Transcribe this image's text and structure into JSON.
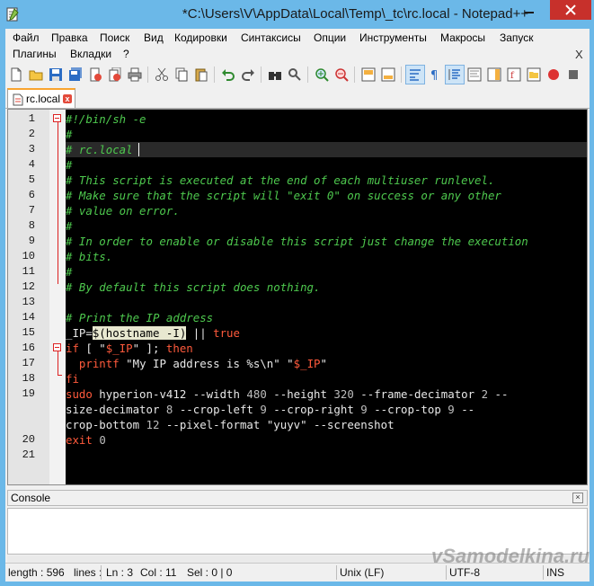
{
  "window": {
    "title": "*C:\\Users\\V\\AppData\\Local\\Temp\\_tc\\rc.local - Notepad++",
    "minimize_label": "minimize",
    "close_label": "close"
  },
  "menu": {
    "items": [
      "Файл",
      "Правка",
      "Поиск",
      "Вид",
      "Кодировки",
      "Синтаксисы",
      "Опции",
      "Инструменты",
      "Макросы",
      "Запуск",
      "Плагины",
      "Вкладки",
      "?"
    ],
    "close_x": "X"
  },
  "tab": {
    "label": "rc.local"
  },
  "editor": {
    "lines": [
      {
        "n": "1",
        "segs": [
          [
            "c-comment",
            "#!/bin/sh -e"
          ]
        ]
      },
      {
        "n": "2",
        "segs": [
          [
            "c-comment",
            "#"
          ]
        ]
      },
      {
        "n": "3",
        "segs": [
          [
            "c-comment",
            "# rc.local"
          ]
        ]
      },
      {
        "n": "4",
        "segs": [
          [
            "c-comment",
            "#"
          ]
        ]
      },
      {
        "n": "5",
        "segs": [
          [
            "c-comment",
            "# This script is executed at the end of each multiuser runlevel."
          ]
        ]
      },
      {
        "n": "6",
        "segs": [
          [
            "c-comment",
            "# Make sure that the script will \"exit 0\" on success or any other"
          ]
        ]
      },
      {
        "n": "7",
        "segs": [
          [
            "c-comment",
            "# value on error."
          ]
        ]
      },
      {
        "n": "8",
        "segs": [
          [
            "c-comment",
            "#"
          ]
        ]
      },
      {
        "n": "9",
        "segs": [
          [
            "c-comment",
            "# In order to enable or disable this script just change the execution"
          ]
        ]
      },
      {
        "n": "10",
        "segs": [
          [
            "c-comment",
            "# bits."
          ]
        ]
      },
      {
        "n": "11",
        "segs": [
          [
            "c-comment",
            "#"
          ]
        ]
      },
      {
        "n": "12",
        "segs": [
          [
            "c-comment",
            "# By default this script does nothing."
          ]
        ]
      },
      {
        "n": "13",
        "segs": []
      },
      {
        "n": "14",
        "segs": [
          [
            "c-comment",
            "# Print the IP address"
          ]
        ]
      },
      {
        "n": "15",
        "segs": [
          [
            "c-plain",
            "_IP="
          ],
          [
            "c-hl",
            "$(hostname -I)"
          ],
          [
            "c-plain",
            " || "
          ],
          [
            "c-kw",
            "true"
          ]
        ]
      },
      {
        "n": "16",
        "segs": [
          [
            "c-kw",
            "if"
          ],
          [
            "c-plain",
            " [ \""
          ],
          [
            "c-kw",
            "$_IP"
          ],
          [
            "c-plain",
            "\" ]; "
          ],
          [
            "c-kw",
            "then"
          ]
        ]
      },
      {
        "n": "17",
        "segs": [
          [
            "c-plain",
            "  "
          ],
          [
            "c-kw",
            "printf"
          ],
          [
            "c-plain",
            " \"My IP address is %s\\n\" \""
          ],
          [
            "c-kw",
            "$_IP"
          ],
          [
            "c-plain",
            "\""
          ]
        ]
      },
      {
        "n": "18",
        "segs": [
          [
            "c-kw",
            "fi"
          ]
        ]
      },
      {
        "n": "19",
        "segs": [
          [
            "c-kw",
            "sudo"
          ],
          [
            "c-plain",
            " hyperion-v412 --width "
          ],
          [
            "c-num",
            "480"
          ],
          [
            "c-plain",
            " --height "
          ],
          [
            "c-num",
            "320"
          ],
          [
            "c-plain",
            " --frame-decimator "
          ],
          [
            "c-num",
            "2"
          ],
          [
            "c-plain",
            " --"
          ]
        ]
      },
      {
        "n": "",
        "segs": [
          [
            "c-plain",
            "size-decimator "
          ],
          [
            "c-num",
            "8"
          ],
          [
            "c-plain",
            " --crop-left "
          ],
          [
            "c-num",
            "9"
          ],
          [
            "c-plain",
            " --crop-right "
          ],
          [
            "c-num",
            "9"
          ],
          [
            "c-plain",
            " --crop-top "
          ],
          [
            "c-num",
            "9"
          ],
          [
            "c-plain",
            " --"
          ]
        ]
      },
      {
        "n": "",
        "segs": [
          [
            "c-plain",
            "crop-bottom "
          ],
          [
            "c-num",
            "12"
          ],
          [
            "c-plain",
            " --pixel-format "
          ],
          [
            "c-plain",
            "\"yuyv\""
          ],
          [
            "c-plain",
            " --screenshot"
          ]
        ]
      },
      {
        "n": "20",
        "segs": [
          [
            "c-kw",
            "exit"
          ],
          [
            "c-plain",
            " "
          ],
          [
            "c-num",
            "0"
          ]
        ]
      },
      {
        "n": "21",
        "segs": []
      }
    ]
  },
  "console": {
    "title": "Console",
    "close": "×"
  },
  "status": {
    "length": "length : 596",
    "lines": "lines :",
    "ln": "Ln : 3",
    "col": "Col : 11",
    "sel": "Sel : 0 | 0",
    "eol": "Unix (LF)",
    "encoding": "UTF-8",
    "mode": "INS"
  },
  "watermark": "vSamodelkina.ru"
}
